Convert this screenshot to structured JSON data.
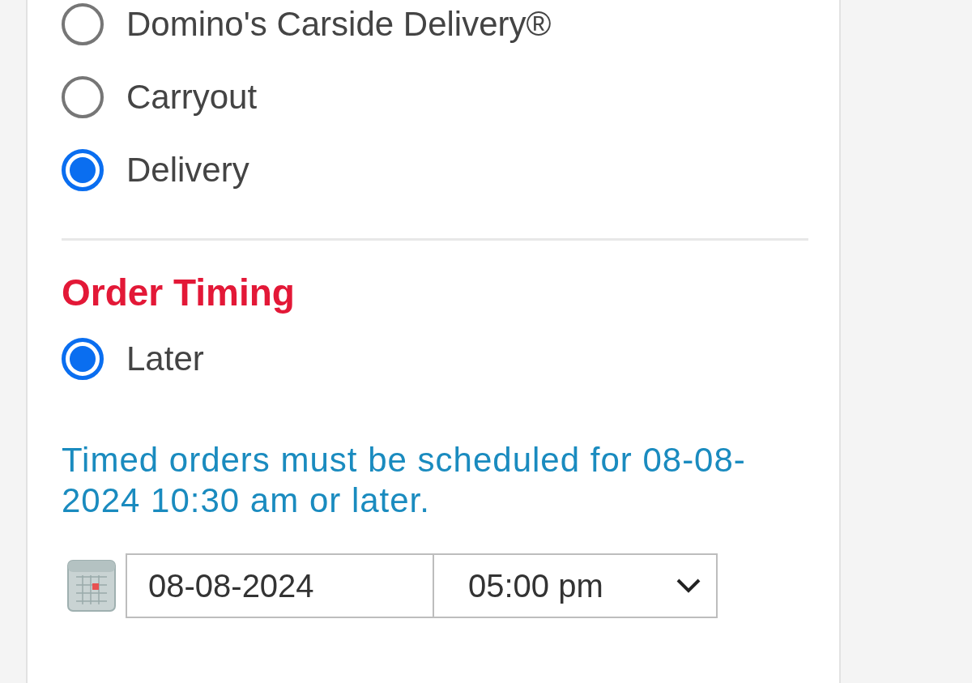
{
  "service_method": {
    "options": [
      {
        "label": "Domino's Carside Delivery®",
        "selected": false
      },
      {
        "label": "Carryout",
        "selected": false
      },
      {
        "label": "Delivery",
        "selected": true
      }
    ]
  },
  "order_timing": {
    "heading": "Order Timing",
    "options": [
      {
        "label": "Later",
        "selected": true
      }
    ],
    "note": "Timed orders must be scheduled for 08-08-2024 10:30 am or later.",
    "date_field": {
      "value": "08-08-2024"
    },
    "time_select": {
      "value": "05:00 pm"
    }
  }
}
